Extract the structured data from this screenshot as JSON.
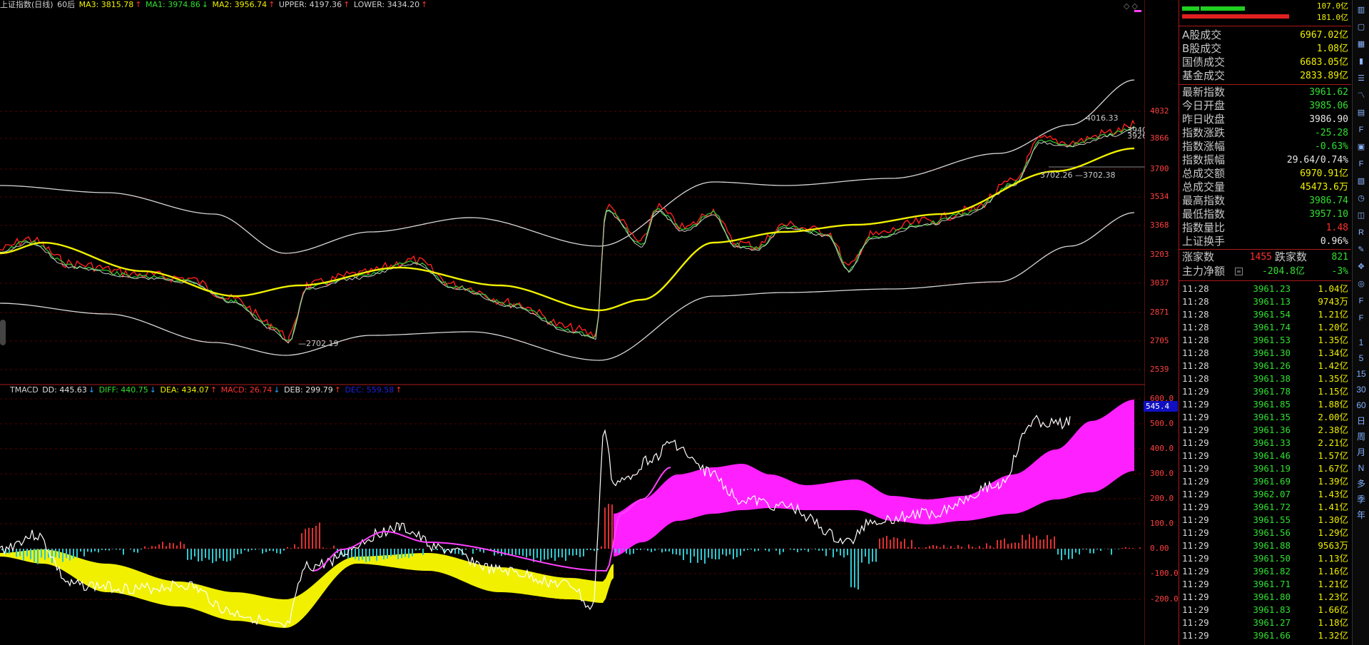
{
  "main_header": {
    "title": "上证指数(日线)",
    "period": "60后",
    "ma3": "MA3: 3815.78",
    "ma1": "MA1: 3974.86",
    "ma2": "MA2: 3956.74",
    "upper": "UPPER: 4197.36",
    "lower": "LOWER: 3434.20"
  },
  "main_axis": [
    "4032",
    "3866",
    "3700",
    "3534",
    "3368",
    "3203",
    "3037",
    "2871",
    "2705",
    "2539"
  ],
  "main_annotations": {
    "high": "4016.33",
    "low": "2702.19",
    "mid_left": "3702.26",
    "mid_right": "3702.38",
    "last1": "3940",
    "last2": "3926"
  },
  "sub_header": {
    "name": "TMACD",
    "dd": "DD: 445.63",
    "diff": "DIFF: 440.75",
    "dea": "DEA: 434.07",
    "macd": "MACD: 26.74",
    "deb": "DEB: 299.79",
    "dec": "DEC: 559.58"
  },
  "sub_axis": [
    "600.0",
    "500.0",
    "400.0",
    "300.0",
    "200.0",
    "100.0",
    "0.00",
    "-100.0",
    "-200.0"
  ],
  "sub_marker": "545.4",
  "side": {
    "bar_top": "107.0亿",
    "bar_bottom": "181.0亿",
    "stats1": [
      {
        "k": "A股成交",
        "v": "6967.02亿",
        "c": "#f0f000"
      },
      {
        "k": "B股成交",
        "v": "1.08亿",
        "c": "#f0f000"
      },
      {
        "k": "国债成交",
        "v": "6683.05亿",
        "c": "#f0f000"
      },
      {
        "k": "基金成交",
        "v": "2833.89亿",
        "c": "#f0f000"
      }
    ],
    "stats2": [
      {
        "k": "最新指数",
        "v": "3961.62",
        "c": "#30e030"
      },
      {
        "k": "今日开盘",
        "v": "3985.06",
        "c": "#30e030"
      },
      {
        "k": "昨日收盘",
        "v": "3986.90",
        "c": "#e8e8e8"
      },
      {
        "k": "指数涨跌",
        "v": "-25.28",
        "c": "#30e030"
      },
      {
        "k": "指数涨幅",
        "v": "-0.63%",
        "c": "#30e030"
      },
      {
        "k": "指数振幅",
        "v": "29.64/0.74%",
        "c": "#e8e8e8"
      },
      {
        "k": "总成交额",
        "v": "6970.91亿",
        "c": "#f0f000"
      },
      {
        "k": "总成交量",
        "v": "45473.6万",
        "c": "#f0f000"
      },
      {
        "k": "最高指数",
        "v": "3986.74",
        "c": "#30e030"
      },
      {
        "k": "最低指数",
        "v": "3957.10",
        "c": "#30e030"
      },
      {
        "k": "指数量比",
        "v": "1.48",
        "c": "#ff3030"
      },
      {
        "k": "上证换手",
        "v": "0.96%",
        "c": "#e8e8e8"
      }
    ],
    "up_label": "涨家数",
    "up_count": "1455",
    "down_label": "跌家数",
    "down_count": "821",
    "flow_label": "主力净额",
    "flow_value": "-204.8亿",
    "flow_pct": "-3%",
    "ticks": [
      [
        "11:28",
        "3961.23",
        "1.04亿"
      ],
      [
        "11:28",
        "3961.13",
        "9743万"
      ],
      [
        "11:28",
        "3961.54",
        "1.21亿"
      ],
      [
        "11:28",
        "3961.74",
        "1.20亿"
      ],
      [
        "11:28",
        "3961.53",
        "1.35亿"
      ],
      [
        "11:28",
        "3961.30",
        "1.34亿"
      ],
      [
        "11:28",
        "3961.26",
        "1.42亿"
      ],
      [
        "11:28",
        "3961.38",
        "1.35亿"
      ],
      [
        "11:29",
        "3961.78",
        "1.15亿"
      ],
      [
        "11:29",
        "3961.85",
        "1.88亿"
      ],
      [
        "11:29",
        "3961.35",
        "2.00亿"
      ],
      [
        "11:29",
        "3961.36",
        "2.38亿"
      ],
      [
        "11:29",
        "3961.33",
        "2.21亿"
      ],
      [
        "11:29",
        "3961.46",
        "1.57亿"
      ],
      [
        "11:29",
        "3961.19",
        "1.67亿"
      ],
      [
        "11:29",
        "3961.69",
        "1.39亿"
      ],
      [
        "11:29",
        "3962.07",
        "1.43亿"
      ],
      [
        "11:29",
        "3961.72",
        "1.41亿"
      ],
      [
        "11:29",
        "3961.55",
        "1.30亿"
      ],
      [
        "11:29",
        "3961.56",
        "1.29亿"
      ],
      [
        "11:29",
        "3961.88",
        "9563万"
      ],
      [
        "11:29",
        "3961.50",
        "1.13亿"
      ],
      [
        "11:29",
        "3961.82",
        "1.16亿"
      ],
      [
        "11:29",
        "3961.71",
        "1.21亿"
      ],
      [
        "11:29",
        "3961.80",
        "1.23亿"
      ],
      [
        "11:29",
        "3961.83",
        "1.66亿"
      ],
      [
        "11:29",
        "3961.27",
        "1.18亿"
      ],
      [
        "11:29",
        "3961.66",
        "1.32亿"
      ]
    ]
  },
  "toolbar": {
    "icons": [
      "kline-icon",
      "window-icon",
      "grid-icon",
      "bar-chart-icon",
      "list-icon",
      "line-chart-icon",
      "table-icon",
      "f10-icon",
      "layers-icon",
      "f2-icon",
      "sheet-icon",
      "clock-icon",
      "chart-icon",
      "rsi-icon",
      "pencil-icon",
      "move-icon",
      "target-icon",
      "f5-icon",
      "f6-icon"
    ],
    "periods": [
      "1",
      "5",
      "15",
      "30",
      "60",
      "日",
      "周",
      "月",
      "N",
      "多",
      "季",
      "年"
    ]
  }
}
